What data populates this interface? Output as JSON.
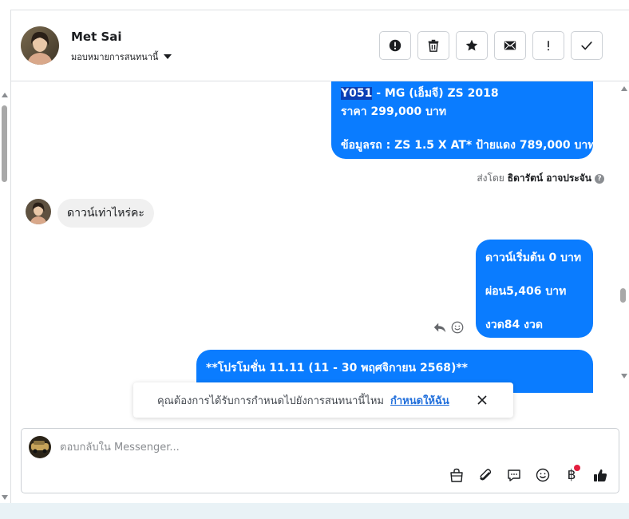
{
  "header": {
    "contact_name": "Met Sai",
    "assign_label": "มอบหมายการสนทนานี้",
    "actions": [
      {
        "name": "mark-spam",
        "icon": "exclamation-circle-icon"
      },
      {
        "name": "delete",
        "icon": "trash-icon"
      },
      {
        "name": "star",
        "icon": "star-icon"
      },
      {
        "name": "mark-unread",
        "icon": "envelope-icon"
      },
      {
        "name": "follow-up",
        "icon": "exclamation-icon"
      },
      {
        "name": "mark-done",
        "icon": "check-icon"
      }
    ]
  },
  "messages": {
    "outgoing_1": {
      "line1_highlight": "Y051",
      "line1_rest": " - MG (เอ็มจี) ZS 2018",
      "line2": "ราคา 299,000 บาท",
      "line3": "ข้อมูลรถ : ZS 1.5 X AT* ป้ายแดง 789,000 บาท"
    },
    "sent_by_prefix": "ส่งโดย",
    "sent_by_name": "ธิดารัตน์ อาจประจัน",
    "incoming_1": "ดาวน์เท่าไหร่คะ",
    "outgoing_2": {
      "line1": "ดาวน์เริ่มต้น 0 บาท",
      "line2": "ผ่อน5,406 บาท",
      "line3": "งวด84 งวด"
    },
    "outgoing_3": {
      "line1": "**โปรโมชั่น 11.11  (11 - 30 พฤศจิกายน 2568)**"
    }
  },
  "notice": {
    "text": "คุณต้องการได้รับการกำหนดไปยังการสนทนานี้ไหม",
    "link": "กำหนดให้ฉัน"
  },
  "composer": {
    "placeholder": "ตอบกลับใน Messenger...",
    "baht_symbol": "฿",
    "tools": [
      "bag-icon",
      "paperclip-icon",
      "chat-bubble-icon",
      "smiley-icon",
      "baht-icon",
      "thumbs-up-icon"
    ]
  },
  "colors": {
    "outgoing_bubble": "#0a7cff",
    "incoming_bubble": "#f0f0f0",
    "link": "#216fdb",
    "highlight": "#0b3fb5",
    "notification_dot": "#e41e3f"
  }
}
